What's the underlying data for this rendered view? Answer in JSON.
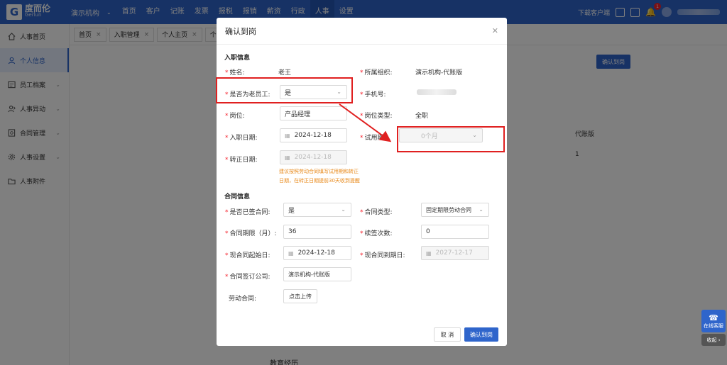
{
  "brand": {
    "cn": "度而伦",
    "en": "Gerlun",
    "mark": "G"
  },
  "topnav": {
    "org": "演示机构",
    "items": [
      "首页",
      "客户",
      "记账",
      "发票",
      "报税",
      "报销",
      "薪资",
      "行政",
      "人事",
      "设置"
    ],
    "active_index": 8
  },
  "topright": {
    "download": "下载客户端",
    "badge_count": "1"
  },
  "sidebar": {
    "items": [
      {
        "label": "人事首页",
        "icon": "home-icon",
        "expandable": false
      },
      {
        "label": "个人信息",
        "icon": "user-icon",
        "expandable": false,
        "active": true
      },
      {
        "label": "员工档案",
        "icon": "profile-icon",
        "expandable": true
      },
      {
        "label": "人事异动",
        "icon": "transfer-icon",
        "expandable": true
      },
      {
        "label": "合同管理",
        "icon": "contract-icon",
        "expandable": true
      },
      {
        "label": "人事设置",
        "icon": "gear-icon",
        "expandable": true
      },
      {
        "label": "人事附件",
        "icon": "folder-icon",
        "expandable": false
      }
    ]
  },
  "tabs": [
    {
      "label": "首页"
    },
    {
      "label": "入职管理"
    },
    {
      "label": "个人主页"
    },
    {
      "label": "个"
    }
  ],
  "background": {
    "confirm_btn": "确认到岗",
    "text1": "代账版",
    "text2": "1",
    "edu": "教育经历"
  },
  "modal": {
    "title": "确认到岗",
    "section1": "入职信息",
    "section2": "合同信息",
    "name_label": "姓名:",
    "name_value": "老王",
    "org_label": "所属组织:",
    "org_value": "演示机构-代账版",
    "old_emp_label": "是否为老员工:",
    "old_emp_value": "是",
    "phone_label": "手机号:",
    "position_label": "岗位:",
    "position_value": "产品经理",
    "pos_type_label": "岗位类型:",
    "pos_type_value": "全职",
    "entry_date_label": "入职日期:",
    "entry_date_value": "2024-12-18",
    "probation_label": "试用期",
    "probation_value": "0个月",
    "regular_date_label": "转正日期:",
    "regular_date_value": "2024-12-18",
    "hint_line1": "建议按照劳动合同填写试用期和转正",
    "hint_line2": "日期，在转正日期提前30天收到提醒",
    "signed_label": "是否已签合同:",
    "signed_value": "是",
    "contract_type_label": "合同类型:",
    "contract_type_value": "固定期限劳动合同",
    "term_label": "合同期限（月）:",
    "term_value": "36",
    "renew_label": "续签次数:",
    "renew_value": "0",
    "start_label": "现合同起始日:",
    "start_value": "2024-12-18",
    "end_label": "现合同到期日:",
    "end_value": "2027-12-17",
    "company_label": "合同签订公司:",
    "company_value": "演示机构-代账版",
    "labor_label": "劳动合同:",
    "upload_btn": "点击上传",
    "cancel_btn": "取 消",
    "ok_btn": "确认到岗"
  },
  "float": {
    "cs": "在线客服",
    "collapse": "收起"
  },
  "colors": {
    "primary": "#2f65cb",
    "annotation": "#e02020",
    "hint": "#e8891a"
  }
}
